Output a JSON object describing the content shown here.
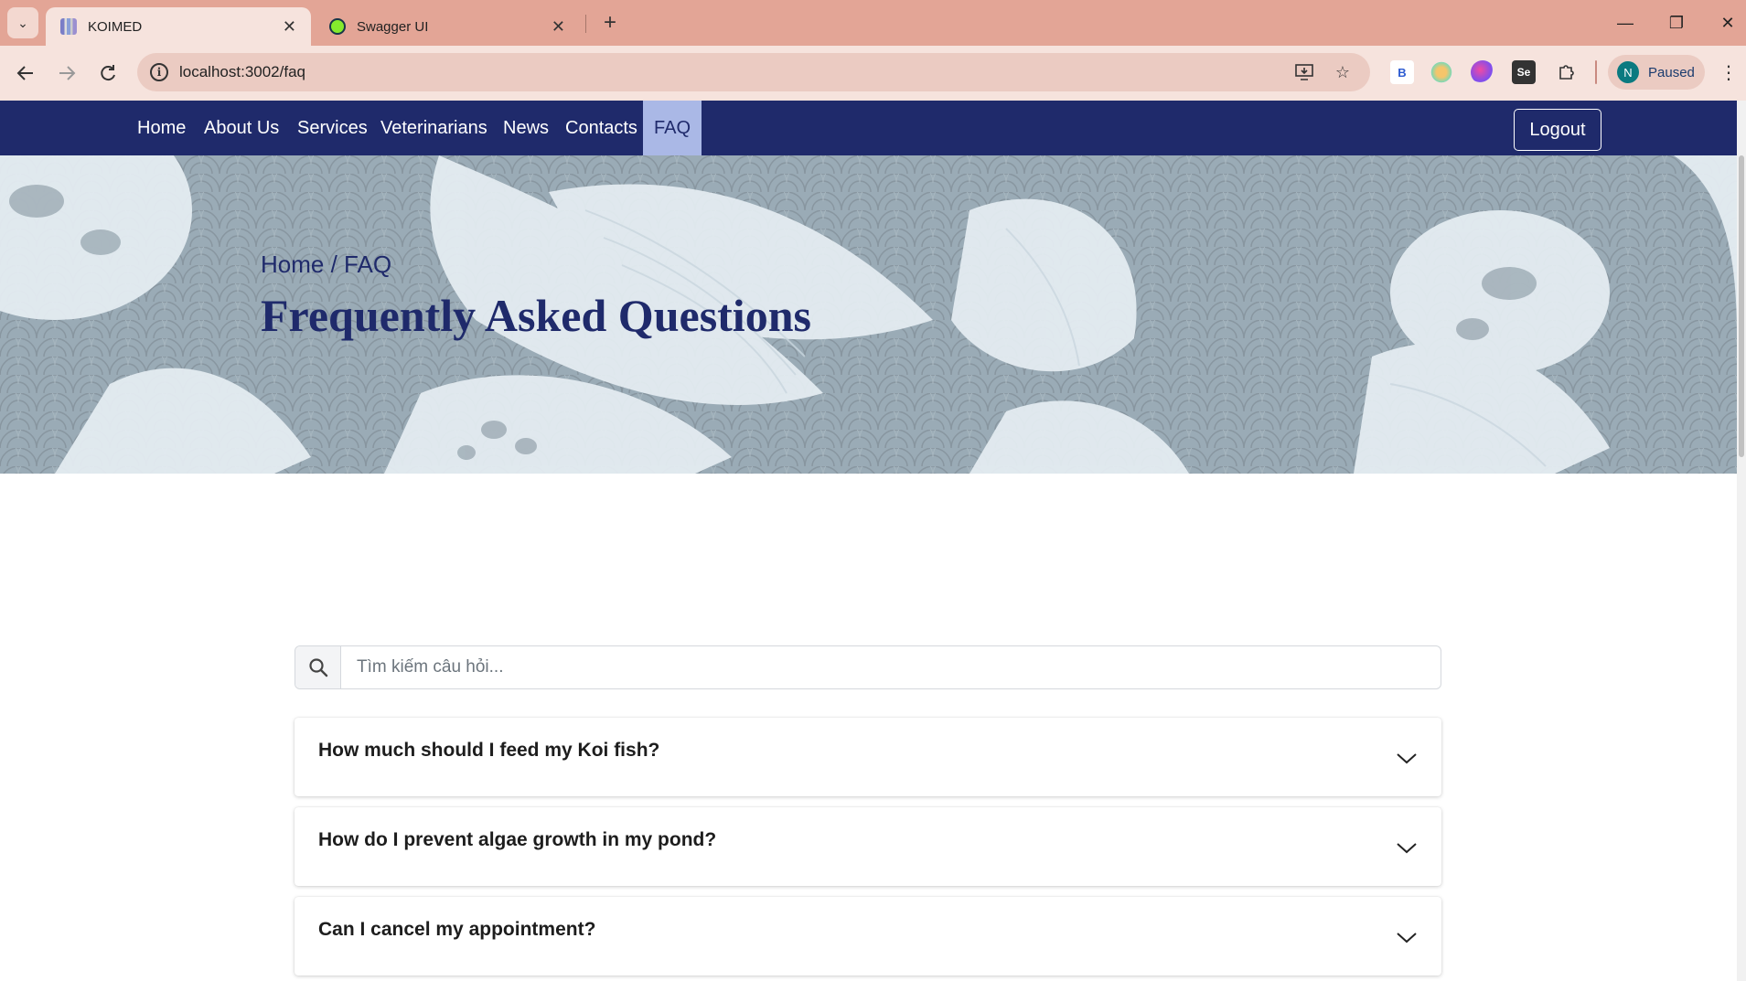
{
  "browser": {
    "tabs": [
      {
        "title": "KOIMED",
        "close": "✕"
      },
      {
        "title": "Swagger UI",
        "close": "✕"
      }
    ],
    "new_tab": "+",
    "url": "localhost:3002/faq",
    "profile_initial": "N",
    "profile_status": "Paused",
    "window_controls": {
      "minimize": "—",
      "restore": "❐",
      "close": "✕"
    }
  },
  "nav": {
    "items": [
      "Home",
      "About Us",
      "Services",
      "Veterinarians",
      "News",
      "Contacts",
      "FAQ"
    ],
    "active": "FAQ",
    "logout": "Logout"
  },
  "hero": {
    "breadcrumb": "Home / FAQ",
    "title": "Frequently Asked Questions"
  },
  "search": {
    "placeholder": "Tìm kiếm câu hỏi..."
  },
  "faq": [
    {
      "question": "How much should I feed my Koi fish?"
    },
    {
      "question": "How do I prevent algae growth in my pond?"
    },
    {
      "question": "Can I cancel my appointment?"
    }
  ],
  "colors": {
    "tabbar": "#e3a596",
    "navbar": "#1f2a6b",
    "nav_active_bg": "#aab8e6",
    "hero_bg": "#9aabb6"
  }
}
